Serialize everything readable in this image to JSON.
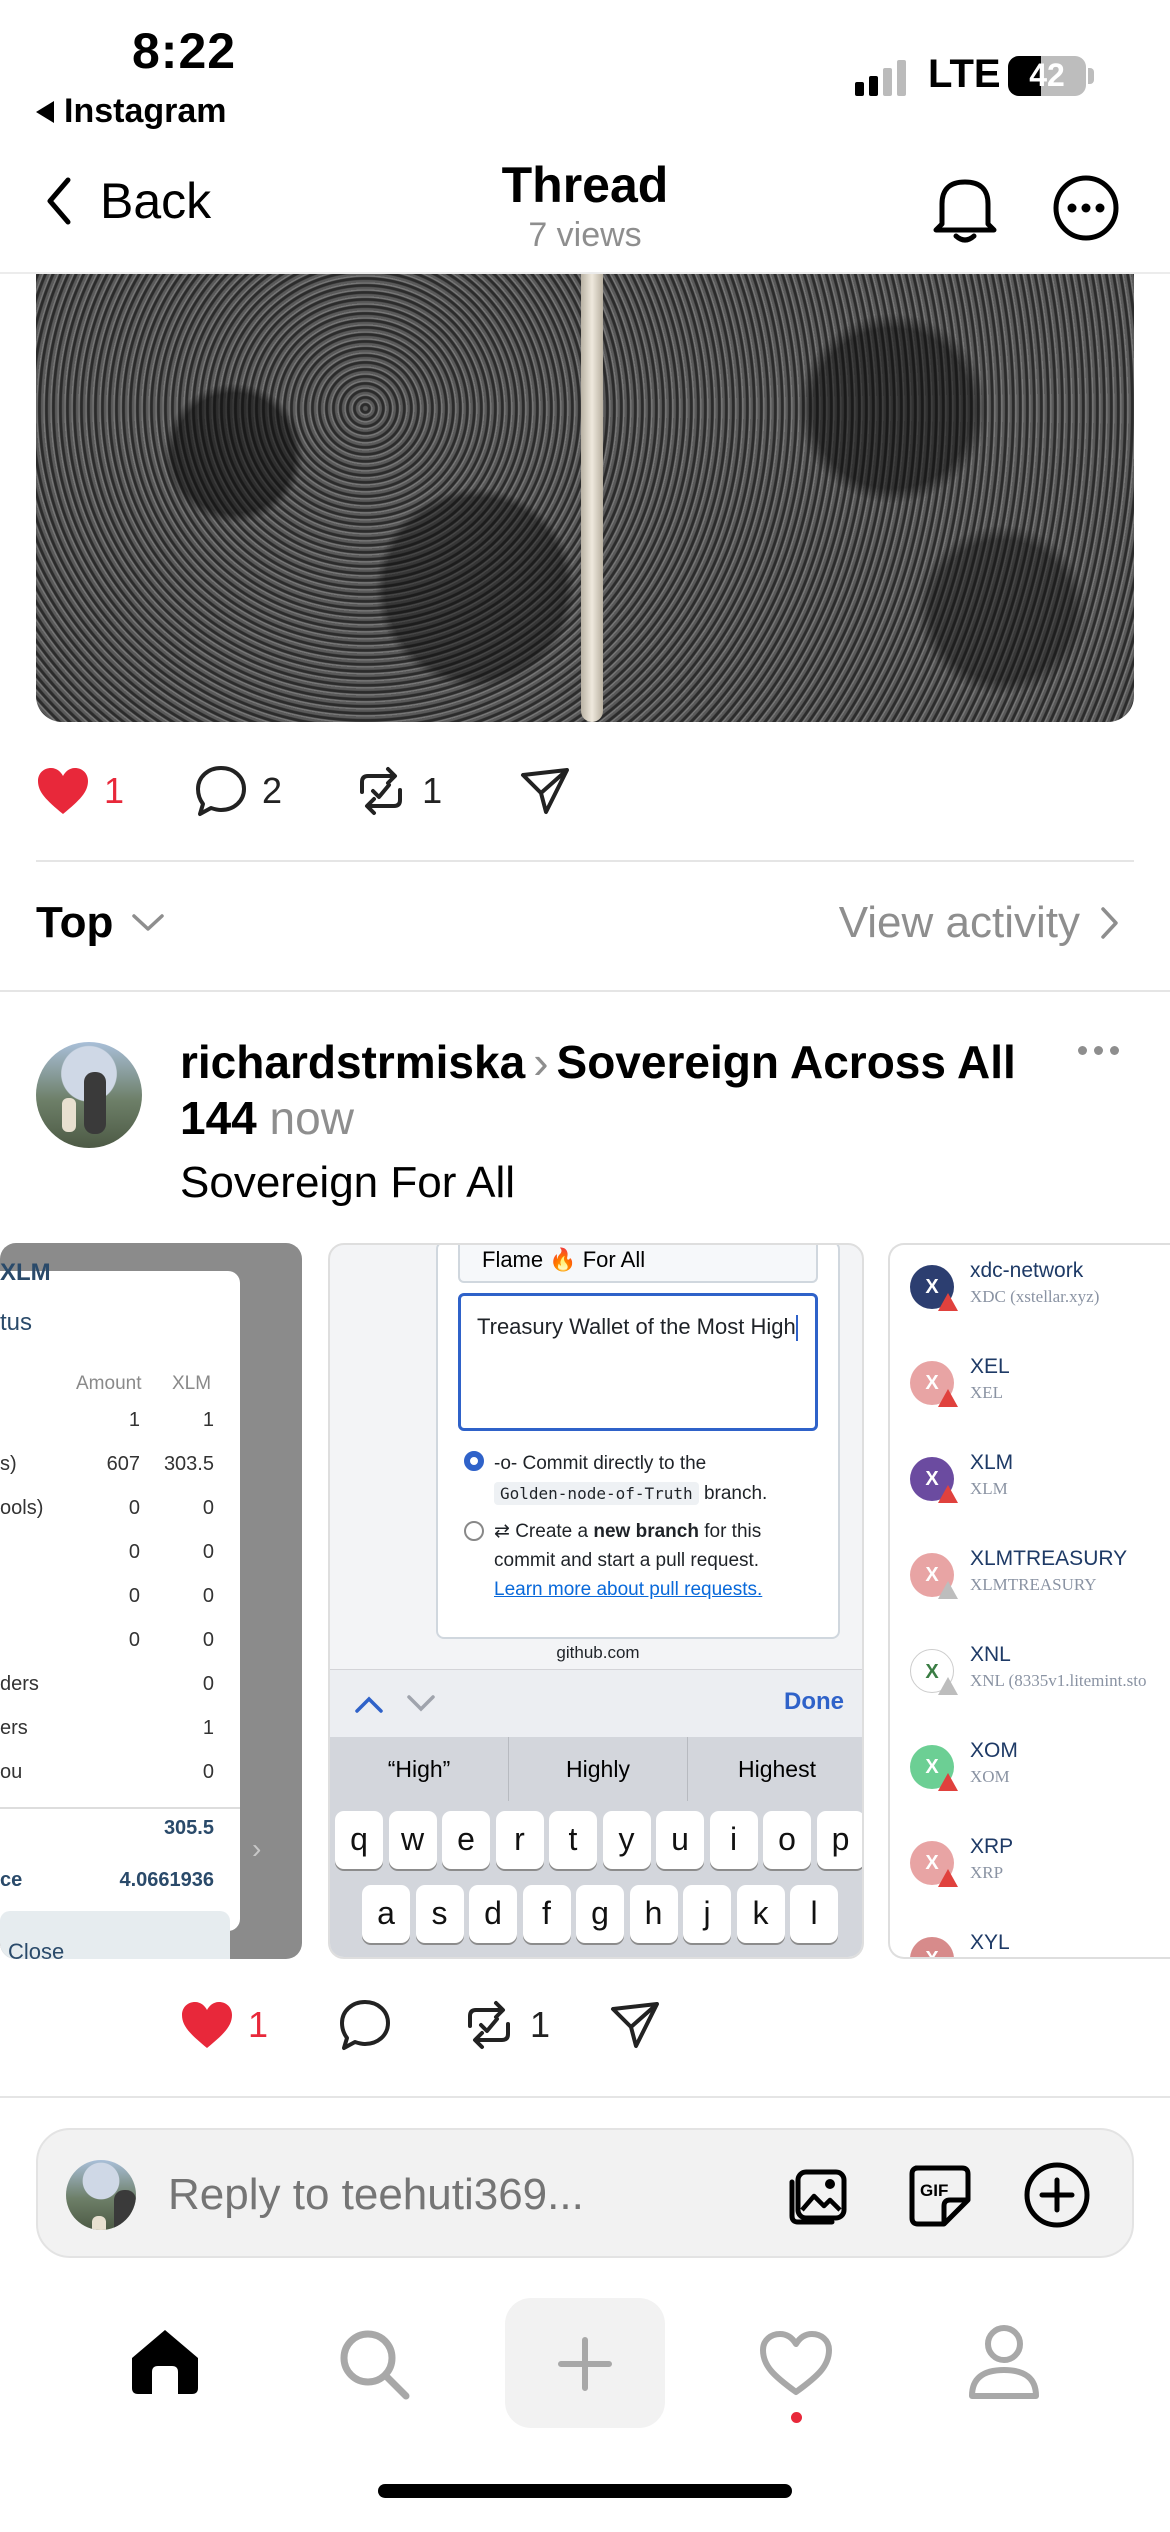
{
  "status_bar": {
    "time": "8:22",
    "back_app": "Instagram",
    "network": "LTE",
    "battery": "42"
  },
  "nav": {
    "back_label": "Back",
    "title": "Thread",
    "subtitle": "7 views"
  },
  "main_post": {
    "likes": "1",
    "comments": "2",
    "reposts": "1"
  },
  "sort": {
    "label": "Top",
    "view_activity": "View activity"
  },
  "reply_post": {
    "author": "richardstrmiska",
    "community": "Sovereign Across All 144",
    "time": "now",
    "body": "Sovereign For All",
    "likes": "1",
    "reposts": "1"
  },
  "card1": {
    "heading": "XLM",
    "status": "tus",
    "col_amount": "Amount",
    "col_xlm": "XLM",
    "rows": [
      {
        "label": "",
        "amount": "1",
        "xlm": "1"
      },
      {
        "label": "s)",
        "amount": "607",
        "xlm": "303.5"
      },
      {
        "label": "ools)",
        "amount": "0",
        "xlm": "0"
      },
      {
        "label": "",
        "amount": "0",
        "xlm": "0"
      },
      {
        "label": "",
        "amount": "0",
        "xlm": "0"
      },
      {
        "label": "",
        "amount": "0",
        "xlm": "0"
      },
      {
        "label": "ders",
        "amount": "",
        "xlm": "0"
      },
      {
        "label": "ers",
        "amount": "",
        "xlm": "1"
      },
      {
        "label": "ou",
        "amount": "",
        "xlm": "0"
      }
    ],
    "total": "305.5",
    "balance_label": "ce",
    "balance": "4.0661936",
    "close": "Close"
  },
  "card2": {
    "field_top": "Flame 🔥 For All",
    "textarea": "Treasury Wallet of the Most High",
    "option1_pre": "Commit directly to the",
    "option1_branch": "Golden-node-of-Truth",
    "option1_post": "branch.",
    "option2_pre": "Create a",
    "option2_bold": "new branch",
    "option2_post": "for this commit and start a pull request.",
    "option2_link": "Learn more about pull requests.",
    "domain": "github.com",
    "done": "Done",
    "suggestions": [
      "“High”",
      "Highly",
      "Highest"
    ],
    "row1": [
      "q",
      "w",
      "e",
      "r",
      "t",
      "y",
      "u",
      "i",
      "o",
      "p"
    ],
    "row2": [
      "a",
      "s",
      "d",
      "f",
      "g",
      "h",
      "j",
      "k",
      "l"
    ]
  },
  "card3": {
    "tokens": [
      {
        "name": "xdc-network",
        "sub": "XDC (xstellar.xyz)",
        "letter": "X",
        "color": "#2c3e70"
      },
      {
        "name": "XEL",
        "sub": "XEL",
        "letter": "X",
        "color": "#e8a4a4"
      },
      {
        "name": "XLM",
        "sub": "XLM",
        "letter": "X",
        "color": "#6b4ba0"
      },
      {
        "name": "XLMTREASURY",
        "sub": "XLMTREASURY",
        "letter": "X",
        "color": "#e8a4a4"
      },
      {
        "name": "XNL",
        "sub": "XNL (8335v1.litemint.sto",
        "letter": "X",
        "color": "#ffffff"
      },
      {
        "name": "XOM",
        "sub": "XOM",
        "letter": "X",
        "color": "#6ccf94"
      },
      {
        "name": "XRP",
        "sub": "XRP",
        "letter": "X",
        "color": "#e8a4a4"
      },
      {
        "name": "XYL",
        "sub": "",
        "letter": "X",
        "color": "#d78b8b"
      }
    ]
  },
  "composer": {
    "placeholder": "Reply to teehuti369..."
  }
}
